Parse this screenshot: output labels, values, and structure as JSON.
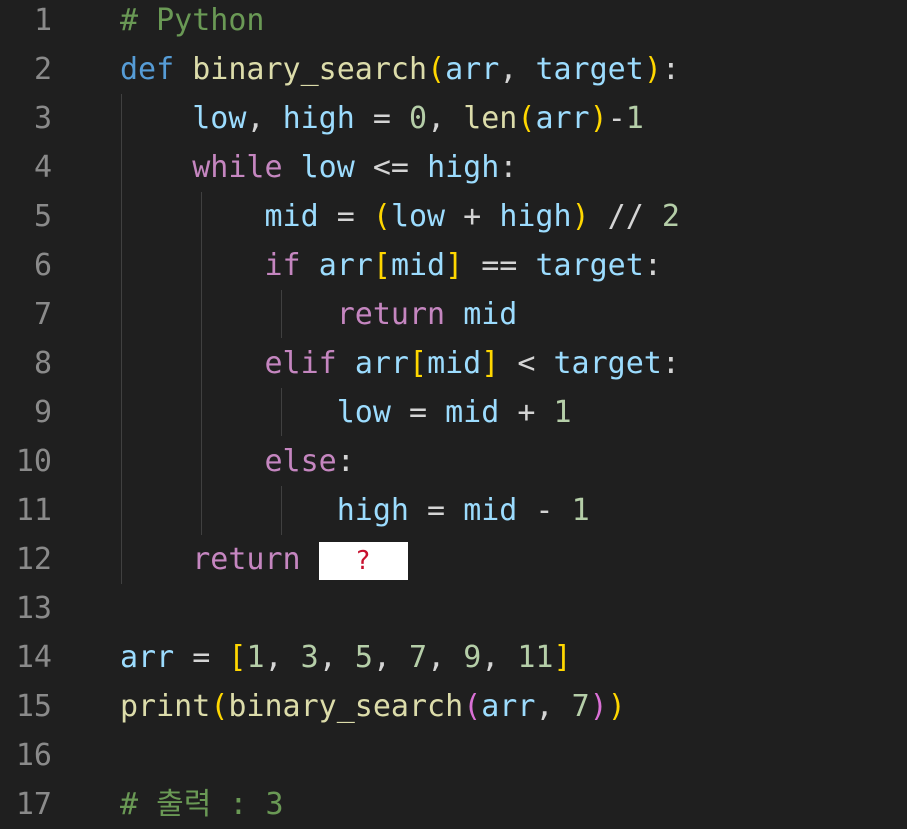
{
  "editor": {
    "language": "Python",
    "masked_blank": "?",
    "lines": [
      {
        "no": "1",
        "tokens": [
          [
            "cm",
            "# Python"
          ]
        ]
      },
      {
        "no": "2",
        "tokens": [
          [
            "kw",
            "def"
          ],
          [
            "op",
            " "
          ],
          [
            "fn",
            "binary_search"
          ],
          [
            "b1",
            "("
          ],
          [
            "var",
            "arr"
          ],
          [
            "op",
            ", "
          ],
          [
            "var",
            "target"
          ],
          [
            "b1",
            ")"
          ],
          [
            "op",
            ":"
          ]
        ]
      },
      {
        "no": "3",
        "tokens": [
          [
            "op",
            "    "
          ],
          [
            "var",
            "low"
          ],
          [
            "op",
            ", "
          ],
          [
            "var",
            "high"
          ],
          [
            "op",
            " = "
          ],
          [
            "num",
            "0"
          ],
          [
            "op",
            ", "
          ],
          [
            "fn",
            "len"
          ],
          [
            "b1",
            "("
          ],
          [
            "var",
            "arr"
          ],
          [
            "b1",
            ")"
          ],
          [
            "op",
            "-"
          ],
          [
            "num",
            "1"
          ]
        ]
      },
      {
        "no": "4",
        "tokens": [
          [
            "op",
            "    "
          ],
          [
            "ctl",
            "while"
          ],
          [
            "op",
            " "
          ],
          [
            "var",
            "low"
          ],
          [
            "op",
            " <= "
          ],
          [
            "var",
            "high"
          ],
          [
            "op",
            ":"
          ]
        ]
      },
      {
        "no": "5",
        "tokens": [
          [
            "op",
            "        "
          ],
          [
            "var",
            "mid"
          ],
          [
            "op",
            " = "
          ],
          [
            "b1",
            "("
          ],
          [
            "var",
            "low"
          ],
          [
            "op",
            " + "
          ],
          [
            "var",
            "high"
          ],
          [
            "b1",
            ")"
          ],
          [
            "op",
            " // "
          ],
          [
            "num",
            "2"
          ]
        ]
      },
      {
        "no": "6",
        "tokens": [
          [
            "op",
            "        "
          ],
          [
            "ctl",
            "if"
          ],
          [
            "op",
            " "
          ],
          [
            "var",
            "arr"
          ],
          [
            "b1",
            "["
          ],
          [
            "var",
            "mid"
          ],
          [
            "b1",
            "]"
          ],
          [
            "op",
            " == "
          ],
          [
            "var",
            "target"
          ],
          [
            "op",
            ":"
          ]
        ]
      },
      {
        "no": "7",
        "tokens": [
          [
            "op",
            "            "
          ],
          [
            "ctl",
            "return"
          ],
          [
            "op",
            " "
          ],
          [
            "var",
            "mid"
          ]
        ]
      },
      {
        "no": "8",
        "tokens": [
          [
            "op",
            "        "
          ],
          [
            "ctl",
            "elif"
          ],
          [
            "op",
            " "
          ],
          [
            "var",
            "arr"
          ],
          [
            "b1",
            "["
          ],
          [
            "var",
            "mid"
          ],
          [
            "b1",
            "]"
          ],
          [
            "op",
            " < "
          ],
          [
            "var",
            "target"
          ],
          [
            "op",
            ":"
          ]
        ]
      },
      {
        "no": "9",
        "tokens": [
          [
            "op",
            "            "
          ],
          [
            "var",
            "low"
          ],
          [
            "op",
            " = "
          ],
          [
            "var",
            "mid"
          ],
          [
            "op",
            " + "
          ],
          [
            "num",
            "1"
          ]
        ]
      },
      {
        "no": "10",
        "tokens": [
          [
            "op",
            "        "
          ],
          [
            "ctl",
            "else"
          ],
          [
            "op",
            ":"
          ]
        ]
      },
      {
        "no": "11",
        "tokens": [
          [
            "op",
            "            "
          ],
          [
            "var",
            "high"
          ],
          [
            "op",
            " = "
          ],
          [
            "var",
            "mid"
          ],
          [
            "op",
            " - "
          ],
          [
            "num",
            "1"
          ]
        ]
      },
      {
        "no": "12",
        "tokens": [
          [
            "op",
            "    "
          ],
          [
            "ctl",
            "return"
          ],
          [
            "op",
            " "
          ],
          [
            "mask",
            "?"
          ]
        ]
      },
      {
        "no": "13",
        "tokens": []
      },
      {
        "no": "14",
        "tokens": [
          [
            "var",
            "arr"
          ],
          [
            "op",
            " = "
          ],
          [
            "b1",
            "["
          ],
          [
            "num",
            "1"
          ],
          [
            "op",
            ", "
          ],
          [
            "num",
            "3"
          ],
          [
            "op",
            ", "
          ],
          [
            "num",
            "5"
          ],
          [
            "op",
            ", "
          ],
          [
            "num",
            "7"
          ],
          [
            "op",
            ", "
          ],
          [
            "num",
            "9"
          ],
          [
            "op",
            ", "
          ],
          [
            "num",
            "11"
          ],
          [
            "b1",
            "]"
          ]
        ]
      },
      {
        "no": "15",
        "tokens": [
          [
            "fn",
            "print"
          ],
          [
            "b1",
            "("
          ],
          [
            "fn",
            "binary_search"
          ],
          [
            "b2",
            "("
          ],
          [
            "var",
            "arr"
          ],
          [
            "op",
            ", "
          ],
          [
            "num",
            "7"
          ],
          [
            "b2",
            ")"
          ],
          [
            "b1",
            ")"
          ]
        ]
      },
      {
        "no": "16",
        "tokens": []
      },
      {
        "no": "17",
        "tokens": [
          [
            "cm",
            "# 출력 : 3"
          ]
        ]
      }
    ]
  }
}
